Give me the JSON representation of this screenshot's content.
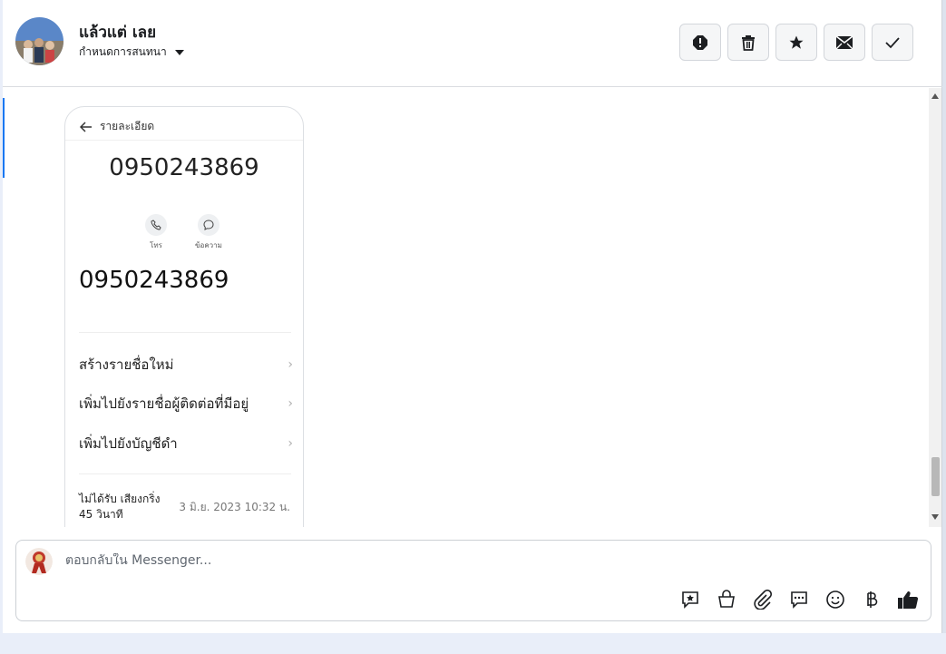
{
  "header": {
    "contact_name": "แล้วแต่ เลย",
    "assign_label": "กำหนดการสนทนา",
    "actions": [
      {
        "name": "report-spam-button",
        "icon": "alert-circle-icon"
      },
      {
        "name": "delete-button",
        "icon": "trash-icon"
      },
      {
        "name": "star-button",
        "icon": "star-icon"
      },
      {
        "name": "mark-unread-button",
        "icon": "envelope-icon"
      },
      {
        "name": "mark-done-button",
        "icon": "checkmark-icon"
      }
    ]
  },
  "message": {
    "screenshot": {
      "back_label": "รายละเอียด",
      "phone_number_top": "0950243869",
      "call_label": "โทร",
      "message_label": "ข้อความ",
      "phone_number_main": "0950243869",
      "options": [
        "สร้างรายชื่อใหม่",
        "เพิ่มไปยังรายชื่อผู้ติดต่อที่มีอยู่",
        "เพิ่มไปยังบัญชีดำ"
      ],
      "missed_line1": "ไม่ได้รับ เสียงกริ่ง",
      "missed_line2": "45 วินาที",
      "missed_time": "3 มิ.ย. 2023 10:32 น."
    }
  },
  "composer": {
    "placeholder": "ตอบกลับใน Messenger...",
    "tools": [
      "saved-reply-icon",
      "shop-bag-icon",
      "attach-icon",
      "chat-bubble-icon",
      "emoji-icon",
      "baht-icon",
      "thumbs-up-icon"
    ]
  }
}
